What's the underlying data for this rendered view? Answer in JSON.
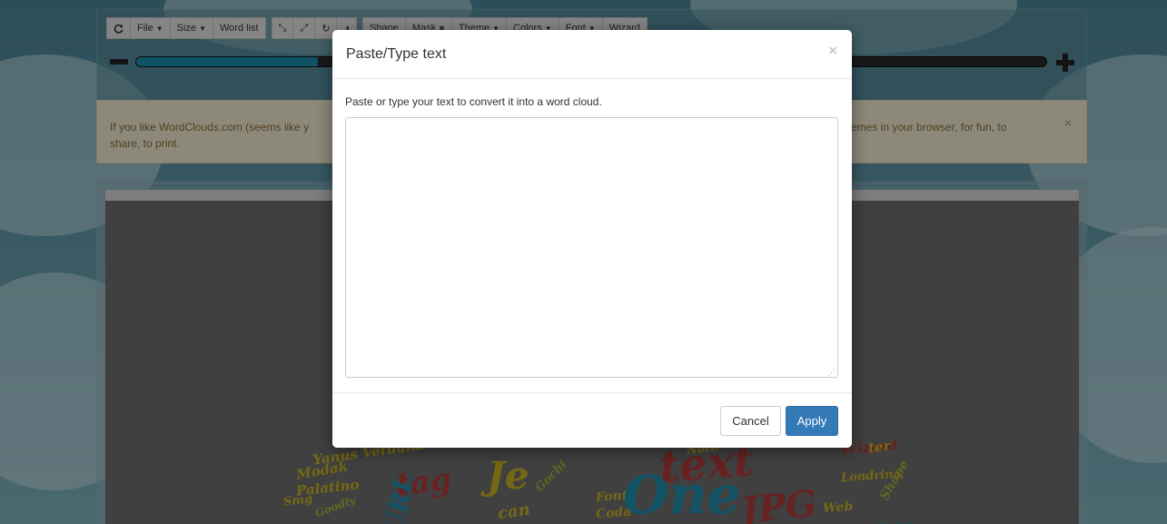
{
  "toolbar": {
    "refresh_icon": "refresh-icon",
    "file_label": "File",
    "size_label": "Size",
    "wordlist_label": "Word list",
    "shape_label": "Shape",
    "mask_label": "Mask",
    "theme_label": "Theme",
    "colors_label": "Colors",
    "font_label": "Font",
    "wizard_label": "Wizard",
    "zoom_fraction": 0.2
  },
  "alert": {
    "text_left": "If you like WordClouds.com (seems like y",
    "text_left_line2": "share, to print.",
    "text_right": "emes in your browser, for fun, to",
    "close_label": "×"
  },
  "cloud_words": [
    {
      "text": "Yanus Verdana",
      "color": "#c9b423"
    },
    {
      "text": "Modak",
      "color": "#c9b423"
    },
    {
      "text": "Palatino",
      "color": "#c9b423"
    },
    {
      "text": "Smg",
      "color": "#c9b423"
    },
    {
      "text": "Goodly",
      "color": "#a7b03a"
    },
    {
      "text": "tag",
      "color": "#b23b3b"
    },
    {
      "text": "Je",
      "color": "#c9b423"
    },
    {
      "text": "URL",
      "color": "#1f8fb0"
    },
    {
      "text": "Gochi",
      "color": "#a7b03a"
    },
    {
      "text": "can",
      "color": "#c9b423"
    },
    {
      "text": "Font",
      "color": "#c9b423"
    },
    {
      "text": "Coda",
      "color": "#c9b423"
    },
    {
      "text": "One",
      "color": "#1f8fb0"
    },
    {
      "text": "text",
      "color": "#b23b3b"
    },
    {
      "text": "Noto",
      "color": "#c9b423"
    },
    {
      "text": "JPG",
      "color": "#b23b3b"
    },
    {
      "text": "Web",
      "color": "#c9b423"
    },
    {
      "text": "Londrina",
      "color": "#c9b423"
    },
    {
      "text": "Wizard",
      "color": "#b23b3b"
    },
    {
      "text": "Limelight",
      "color": "#1f8fb0"
    },
    {
      "text": "Shape",
      "color": "#a7b03a"
    },
    {
      "text": "ter",
      "color": "#c9b423"
    }
  ],
  "modal": {
    "title": "Paste/Type text",
    "close_label": "×",
    "description": "Paste or type your text to convert it into a word cloud.",
    "textarea_value": "",
    "cancel_label": "Cancel",
    "apply_label": "Apply"
  }
}
